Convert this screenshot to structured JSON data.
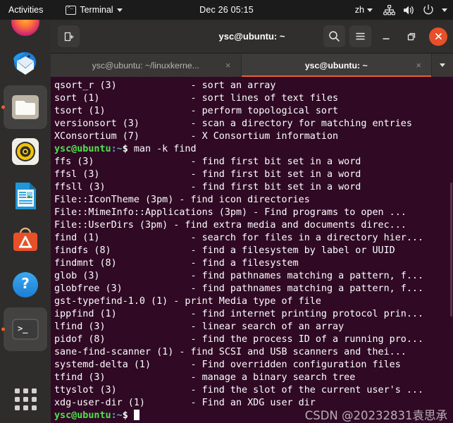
{
  "topbar": {
    "activities": "Activities",
    "app_menu": {
      "label": "Terminal",
      "icon": "terminal-icon",
      "caret": "chevron-down-icon"
    },
    "clock": "Dec 26  05:15",
    "language": "zh",
    "tray": [
      "network-icon",
      "volume-icon",
      "power-icon",
      "chevron-down-icon"
    ]
  },
  "dock": {
    "items": [
      {
        "name": "firefox",
        "label": "Firefox",
        "running": false
      },
      {
        "name": "thunderbird",
        "label": "Thunderbird Mail",
        "running": false
      },
      {
        "name": "files",
        "label": "Files",
        "running": true
      },
      {
        "name": "rhythmbox",
        "label": "Rhythmbox",
        "running": false
      },
      {
        "name": "libreoffice-writer",
        "label": "LibreOffice Writer",
        "running": false
      },
      {
        "name": "ubuntu-software",
        "label": "Ubuntu Software",
        "running": false
      },
      {
        "name": "help",
        "label": "Help",
        "running": false
      },
      {
        "name": "terminal",
        "label": "Terminal",
        "running": true
      }
    ],
    "show_apps": "Show Applications"
  },
  "window": {
    "title": "ysc@ubuntu: ~",
    "new_tab_label": "+",
    "search_icon": "search-icon",
    "menu_icon": "hamburger-menu-icon",
    "minimize_icon": "minimize-icon",
    "maximize_icon": "maximize-icon",
    "close_icon": "close-icon",
    "tabs": [
      {
        "label": "ysc@ubuntu: ~/linuxkerne...",
        "active": false,
        "close": "×"
      },
      {
        "label": "ysc@ubuntu: ~",
        "active": true,
        "close": "×"
      }
    ],
    "tab_list_icon": "chevron-down-icon"
  },
  "terminal": {
    "prompt": {
      "user": "ysc@ubuntu",
      "path": ":~",
      "dollar": "$ "
    },
    "lines": [
      {
        "type": "out",
        "text": "qsort_r (3)             - sort an array"
      },
      {
        "type": "out",
        "text": "sort (1)                - sort lines of text files"
      },
      {
        "type": "out",
        "text": "tsort (1)               - perform topological sort"
      },
      {
        "type": "out",
        "text": "versionsort (3)         - scan a directory for matching entries"
      },
      {
        "type": "out",
        "text": "XConsortium (7)         - X Consortium information"
      },
      {
        "type": "cmd",
        "text": "man -k find"
      },
      {
        "type": "out",
        "text": "ffs (3)                 - find first bit set in a word"
      },
      {
        "type": "out",
        "text": "ffsl (3)                - find first bit set in a word"
      },
      {
        "type": "out",
        "text": "ffsll (3)               - find first bit set in a word"
      },
      {
        "type": "out",
        "text": "File::IconTheme (3pm) - find icon directories"
      },
      {
        "type": "out",
        "text": "File::MimeInfo::Applications (3pm) - Find programs to open ..."
      },
      {
        "type": "out",
        "text": "File::UserDirs (3pm) - find extra media and documents direc..."
      },
      {
        "type": "out",
        "text": "find (1)                - search for files in a directory hier..."
      },
      {
        "type": "out",
        "text": "findfs (8)              - find a filesystem by label or UUID"
      },
      {
        "type": "out",
        "text": "findmnt (8)             - find a filesystem"
      },
      {
        "type": "out",
        "text": "glob (3)                - find pathnames matching a pattern, f..."
      },
      {
        "type": "out",
        "text": "globfree (3)            - find pathnames matching a pattern, f..."
      },
      {
        "type": "out",
        "text": "gst-typefind-1.0 (1) - print Media type of file"
      },
      {
        "type": "out",
        "text": "ippfind (1)             - find internet printing protocol prin..."
      },
      {
        "type": "out",
        "text": "lfind (3)               - linear search of an array"
      },
      {
        "type": "out",
        "text": "pidof (8)               - find the process ID of a running pro..."
      },
      {
        "type": "out",
        "text": "sane-find-scanner (1) - find SCSI and USB scanners and thei..."
      },
      {
        "type": "out",
        "text": "systemd-delta (1)       - Find overridden configuration files"
      },
      {
        "type": "out",
        "text": "tfind (3)               - manage a binary search tree"
      },
      {
        "type": "out",
        "text": "ttyslot (3)             - find the slot of the current user's ..."
      },
      {
        "type": "out",
        "text": "xdg-user-dir (1)        - Find an XDG user dir"
      },
      {
        "type": "cmd-cursor",
        "text": ""
      }
    ],
    "watermark": "CSDN @20232831袁思承"
  },
  "colors": {
    "terminal_bg": "#300a24",
    "titlebar_bg": "#302f2e",
    "tabbar_bg": "#383736",
    "accent_orange": "#e8602c",
    "dock_bg": "#2f2d2c",
    "topbar_bg": "#1b1b1b",
    "prompt_green": "#4ee24e",
    "prompt_blue": "#6a9ec5"
  }
}
